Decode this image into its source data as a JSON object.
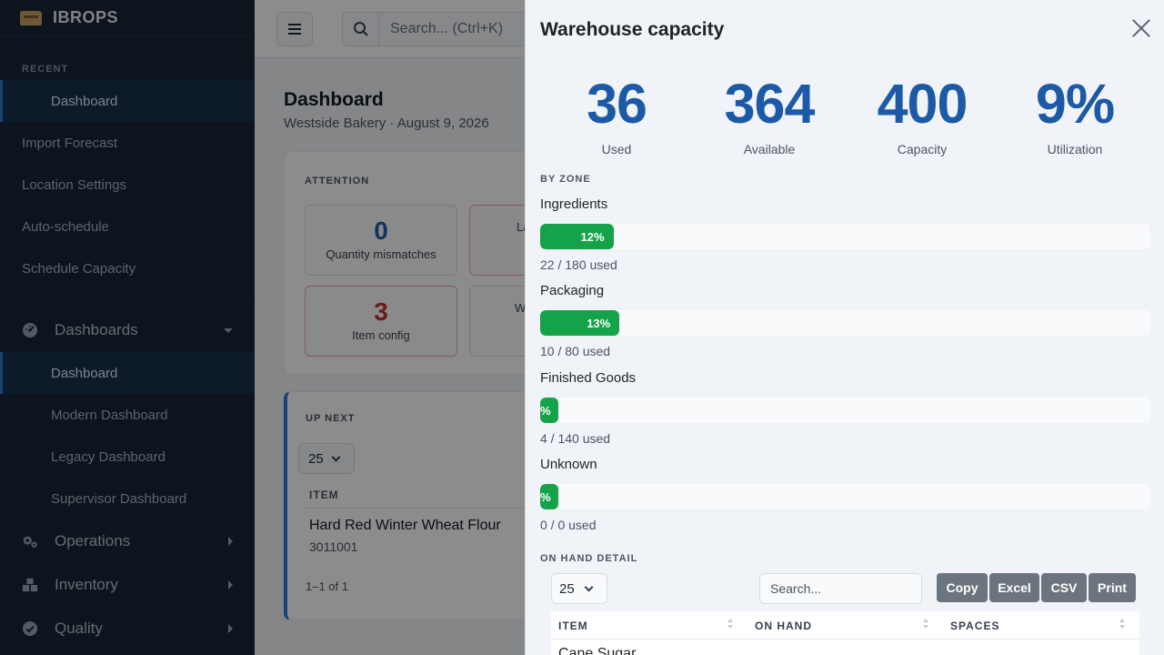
{
  "brand": {
    "name": "IBROPS"
  },
  "sidebar": {
    "recent_label": "RECENT",
    "recent_items": [
      {
        "label": "Dashboard"
      }
    ],
    "links": [
      {
        "label": "Import Forecast"
      },
      {
        "label": "Location Settings"
      },
      {
        "label": "Auto-schedule"
      },
      {
        "label": "Schedule Capacity"
      }
    ],
    "groups": [
      {
        "label": "Dashboards",
        "icon": "dashboard-gauge-icon"
      },
      {
        "label": "Operations",
        "icon": "gears-icon"
      },
      {
        "label": "Inventory",
        "icon": "boxes-icon"
      },
      {
        "label": "Quality",
        "icon": "check-circle-icon"
      }
    ],
    "dashboard_items": [
      {
        "label": "Dashboard"
      },
      {
        "label": "Modern Dashboard"
      },
      {
        "label": "Legacy Dashboard"
      },
      {
        "label": "Supervisor Dashboard"
      }
    ]
  },
  "topbar": {
    "search_placeholder": "Search... (Ctrl+K)"
  },
  "page": {
    "title": "Dashboard",
    "subtitle": "Westside Bakery · August 9, 2026",
    "attention": {
      "label": "ATTENTION",
      "tiles": [
        {
          "value": "0",
          "label": "Quantity mismatches"
        },
        {
          "value": "",
          "label": "La"
        },
        {
          "value": "3",
          "label": "Item config"
        },
        {
          "value": "",
          "label": "W"
        }
      ]
    },
    "up_next": {
      "label": "UP NEXT",
      "page_size": "25",
      "column": "ITEM",
      "item_name": "Hard Red Winter Wheat Flour",
      "item_code": "3011001",
      "footer": "1–1 of 1"
    }
  },
  "panel": {
    "title": "Warehouse capacity",
    "stats": [
      {
        "value": "36",
        "label": "Used"
      },
      {
        "value": "364",
        "label": "Available"
      },
      {
        "value": "400",
        "label": "Capacity"
      },
      {
        "value": "9%",
        "label": "Utilization"
      }
    ],
    "by_zone_label": "BY ZONE",
    "zones": [
      {
        "name": "Ingredients",
        "percent": 12,
        "percent_label": "12%",
        "used": "22 / 180 used"
      },
      {
        "name": "Packaging",
        "percent": 13,
        "percent_label": "13%",
        "used": "10 / 80 used"
      },
      {
        "name": "Finished Goods",
        "percent": 3,
        "percent_label": "%",
        "used": "4 / 140 used"
      },
      {
        "name": "Unknown",
        "percent": 3,
        "percent_label": "%",
        "used": "0 / 0 used"
      }
    ],
    "on_hand_label": "ON HAND DETAIL",
    "table": {
      "page_size": "25",
      "search_placeholder": "Search...",
      "buttons": [
        {
          "label": "Copy"
        },
        {
          "label": "Excel"
        },
        {
          "label": "CSV"
        },
        {
          "label": "Print"
        }
      ],
      "columns": [
        {
          "label": "ITEM"
        },
        {
          "label": "ON HAND"
        },
        {
          "label": "SPACES"
        }
      ],
      "rows": [
        {
          "item": "Cane Sugar"
        }
      ]
    }
  },
  "colors": {
    "sidebar_bg": "#1a2536",
    "accent": "#2b7bd8",
    "stat_blue": "#1c5aa6",
    "bar_green": "#15a34a",
    "button_gray": "#6c757d",
    "danger_red": "#c0332d"
  }
}
